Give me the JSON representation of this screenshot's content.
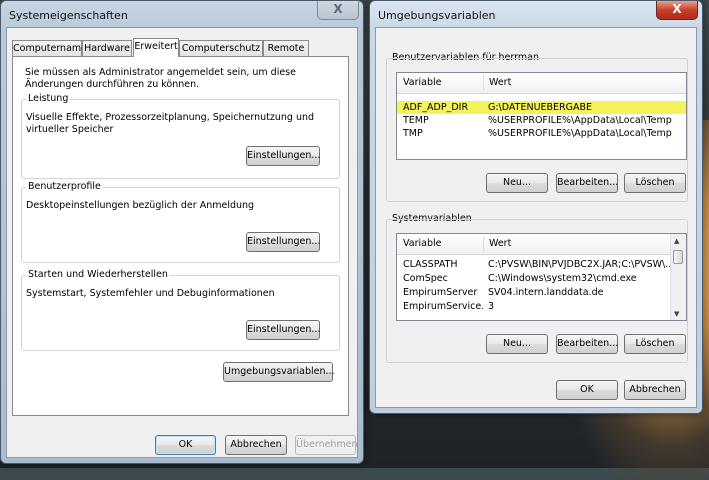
{
  "sysprops": {
    "title": "Systemeigenschaften",
    "close": "X",
    "tabs": [
      {
        "label": "Computername"
      },
      {
        "label": "Hardware"
      },
      {
        "label": "Erweitert"
      },
      {
        "label": "Computerschutz"
      },
      {
        "label": "Remote"
      }
    ],
    "admin_note": "Sie müssen als Administrator angemeldet sein, um diese Änderungen durchführen zu können.",
    "groups": [
      {
        "label": "Leistung",
        "text": "Visuelle Effekte, Prozessorzeitplanung, Speichernutzung und virtueller Speicher",
        "button": "Einstellungen..."
      },
      {
        "label": "Benutzerprofile",
        "text": "Desktopeinstellungen bezüglich der Anmeldung",
        "button": "Einstellungen..."
      },
      {
        "label": "Starten und Wiederherstellen",
        "text": "Systemstart, Systemfehler und Debuginformationen",
        "button": "Einstellungen..."
      }
    ],
    "env_button": "Umgebungsvariablen...",
    "ok": "OK",
    "cancel": "Abbrechen",
    "apply": "Übernehmen"
  },
  "envvars": {
    "title": "Umgebungsvariablen",
    "close": "X",
    "user_section": "Benutzervariablen für herrman",
    "columns": {
      "variable": "Variable",
      "value": "Wert"
    },
    "user_vars": [
      {
        "name": "ADF_ADP_DIR",
        "value": "G:\\DATENUEBERGABE"
      },
      {
        "name": "TEMP",
        "value": "%USERPROFILE%\\AppData\\Local\\Temp"
      },
      {
        "name": "TMP",
        "value": "%USERPROFILE%\\AppData\\Local\\Temp"
      }
    ],
    "user_buttons": {
      "new": "Neu...",
      "edit": "Bearbeiten...",
      "delete": "Löschen"
    },
    "system_section": "Systemvariablen",
    "system_vars": [
      {
        "name": "CLASSPATH",
        "value": "C:\\PVSW\\BIN\\PVJDBC2X.JAR;C:\\PVSW\\..."
      },
      {
        "name": "ComSpec",
        "value": "C:\\Windows\\system32\\cmd.exe"
      },
      {
        "name": "EmpirumServer",
        "value": "SV04.intern.landdata.de"
      },
      {
        "name": "EmpirumService...",
        "value": "3"
      }
    ],
    "system_buttons": {
      "new": "Neu...",
      "edit": "Bearbeiten...",
      "delete": "Löschen"
    },
    "ok": "OK",
    "cancel": "Abbrechen"
  }
}
